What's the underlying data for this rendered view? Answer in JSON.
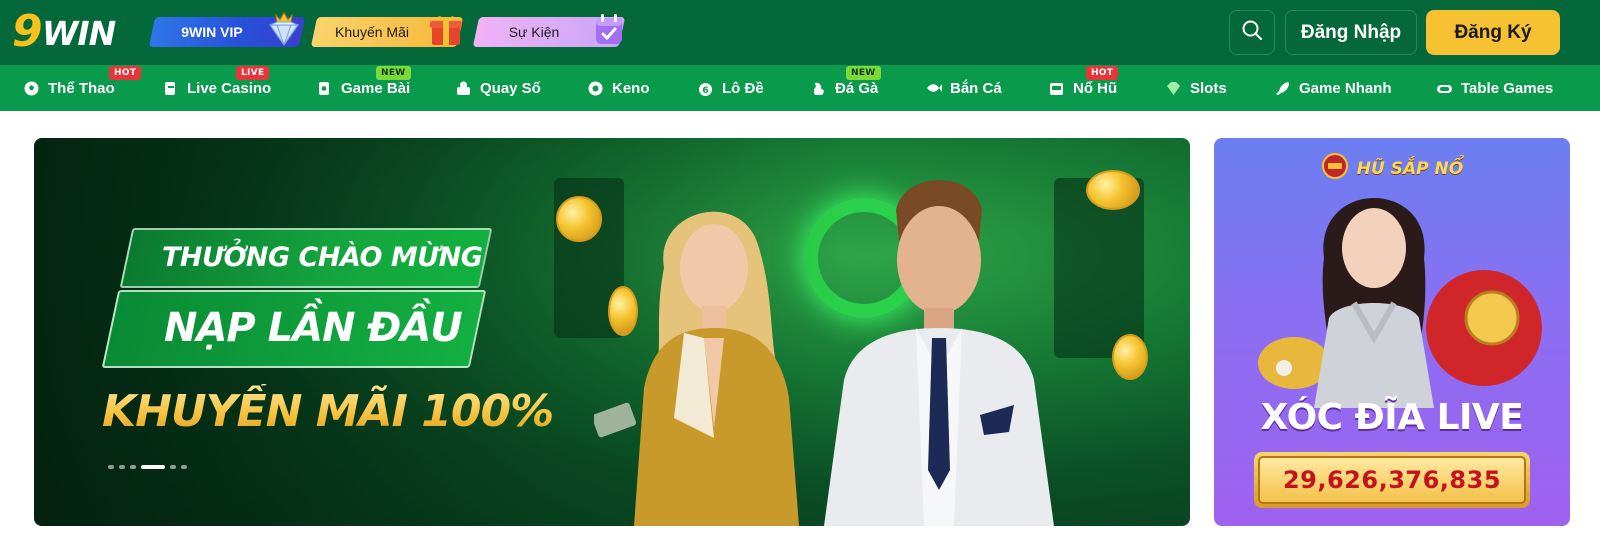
{
  "header": {
    "logo_nine": "9",
    "logo_win": "WIN",
    "pills": {
      "vip": "9WIN VIP",
      "promo": "Khuyến Mãi",
      "events": "Sự Kiện"
    },
    "login_label": "Đăng Nhập",
    "register_label": "Đăng Ký"
  },
  "nav": {
    "items": [
      {
        "label": "Thể Thao",
        "icon": "soccer-ball-icon",
        "badge": "HOT"
      },
      {
        "label": "Live Casino",
        "icon": "casino-chip-icon",
        "badge": "LIVE"
      },
      {
        "label": "Game Bài",
        "icon": "playing-cards-icon",
        "badge": "NEW"
      },
      {
        "label": "Quay Số",
        "icon": "lottery-ball-icon",
        "badge": ""
      },
      {
        "label": "Keno",
        "icon": "keno-icon",
        "badge": ""
      },
      {
        "label": "Lô Đề",
        "icon": "number-ball-icon",
        "badge": ""
      },
      {
        "label": "Đá Gà",
        "icon": "rooster-icon",
        "badge": "NEW"
      },
      {
        "label": "Bắn Cá",
        "icon": "fish-icon",
        "badge": ""
      },
      {
        "label": "Nổ Hũ",
        "icon": "slot-machine-icon",
        "badge": "HOT"
      },
      {
        "label": "Slots",
        "icon": "diamond-icon",
        "badge": ""
      },
      {
        "label": "Game Nhanh",
        "icon": "rocket-icon",
        "badge": ""
      },
      {
        "label": "Table Games",
        "icon": "table-icon",
        "badge": ""
      }
    ]
  },
  "banner": {
    "line1": "THƯỞNG CHÀO MỪNG",
    "line2": "NẠP LẦN ĐẦU",
    "line3": "KHUYẾN MÃI 100%",
    "slide_count": 6,
    "active_slide": 4
  },
  "promo": {
    "title": "HŨ SẮP NỔ",
    "game": "XÓC ĐĨA LIVE",
    "jackpot": "29,626,376,835"
  },
  "colors": {
    "header_bg": "#05683a",
    "nav_bg": "#0a9a4c",
    "accent_yellow": "#f6c233"
  }
}
